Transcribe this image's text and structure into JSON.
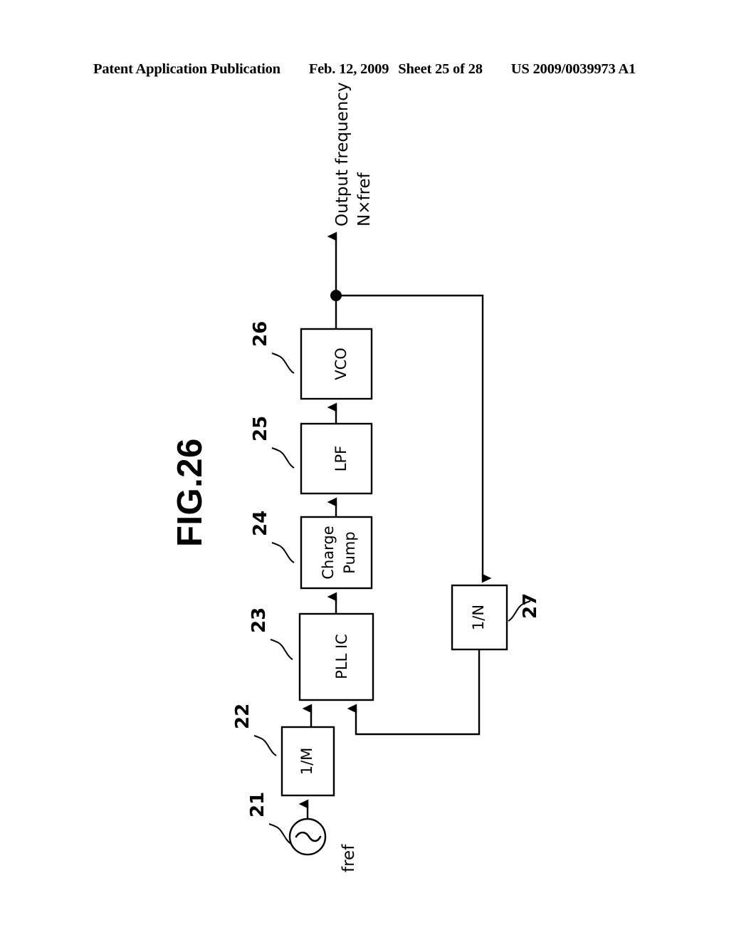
{
  "header": {
    "publication": "Patent Application Publication",
    "date": "Feb. 12, 2009",
    "sheet": "Sheet 25 of 28",
    "document_number": "US 2009/0039973 A1"
  },
  "figure": {
    "title": "FIG.26",
    "output_label_line1": "Output frequency",
    "output_label_line2": "N×fref",
    "input_label": "fref",
    "blocks": [
      {
        "id": "source",
        "label": "",
        "ref": "21"
      },
      {
        "id": "divider-m",
        "label": "1/M",
        "ref": "22"
      },
      {
        "id": "pll-ic",
        "label": "PLL  IC",
        "ref": "23"
      },
      {
        "id": "charge-pump",
        "label_line1": "Charge",
        "label_line2": "Pump",
        "ref": "24"
      },
      {
        "id": "lpf",
        "label": "LPF",
        "ref": "25"
      },
      {
        "id": "vco",
        "label": "VCO",
        "ref": "26"
      },
      {
        "id": "divider-n",
        "label": "1/N",
        "ref": "27"
      }
    ]
  },
  "colors": {
    "ink": "#000000",
    "paper": "#ffffff"
  }
}
